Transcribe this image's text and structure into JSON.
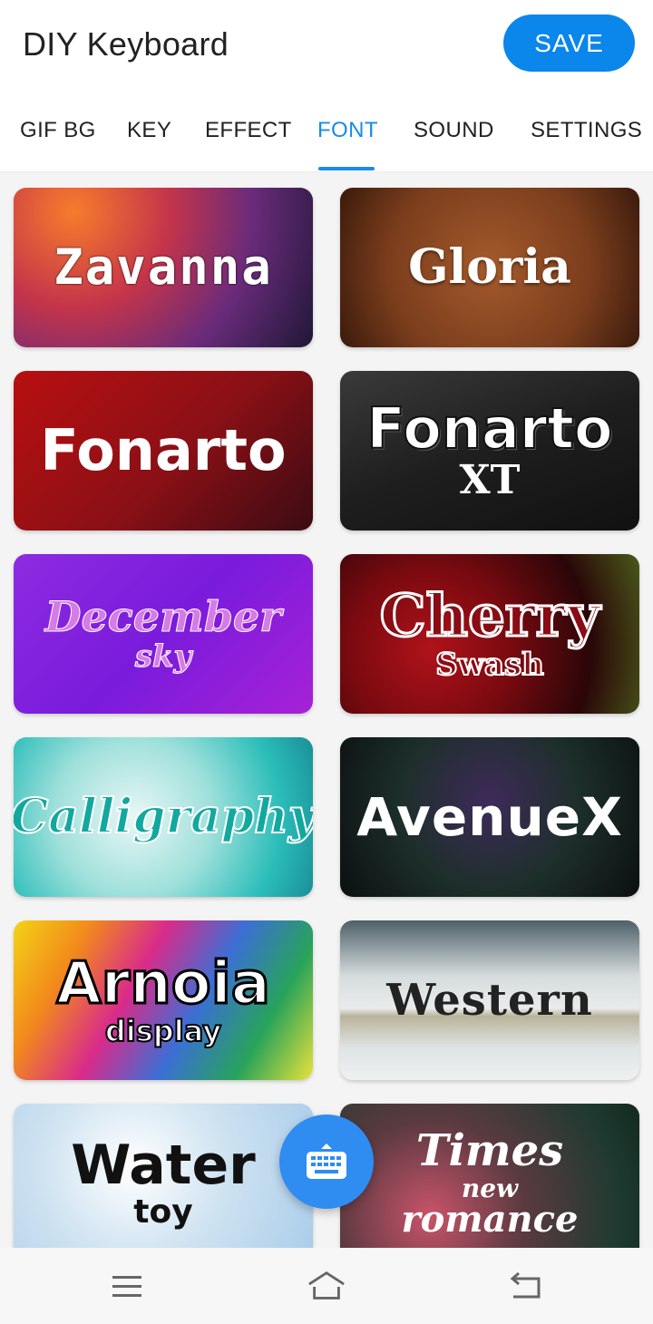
{
  "app": {
    "title": "DIY Keyboard",
    "save_label": "SAVE",
    "accent_color": "#1a8be8"
  },
  "tabs": [
    {
      "label": "GIF BG",
      "active": false
    },
    {
      "label": "KEY",
      "active": false
    },
    {
      "label": "EFFECT",
      "active": false
    },
    {
      "label": "FONT",
      "active": true
    },
    {
      "label": "SOUND",
      "active": false
    },
    {
      "label": "SETTINGS",
      "active": false
    }
  ],
  "fonts": [
    {
      "line1": "Zavanna",
      "line2": "",
      "line3": ""
    },
    {
      "line1": "Gloria",
      "line2": "",
      "line3": ""
    },
    {
      "line1": "Fonarto",
      "line2": "",
      "line3": ""
    },
    {
      "line1": "Fonarto",
      "line2": "XT",
      "line3": ""
    },
    {
      "line1": "December",
      "line2": "sky",
      "line3": ""
    },
    {
      "line1": "Cherry",
      "line2": "Swash",
      "line3": ""
    },
    {
      "line1": "Calligraphy",
      "line2": "",
      "line3": ""
    },
    {
      "line1": "AvenueX",
      "line2": "",
      "line3": ""
    },
    {
      "line1": "Arnoia",
      "line2": "display",
      "line3": ""
    },
    {
      "line1": "Western",
      "line2": "",
      "line3": ""
    },
    {
      "line1": "Water",
      "line2": "toy",
      "line3": ""
    },
    {
      "line1": "Times",
      "line2": "new",
      "line3": "romance"
    }
  ],
  "icons": {
    "fab": "keyboard-icon",
    "nav_menu": "menu-icon",
    "nav_home": "home-icon",
    "nav_back": "back-icon"
  }
}
